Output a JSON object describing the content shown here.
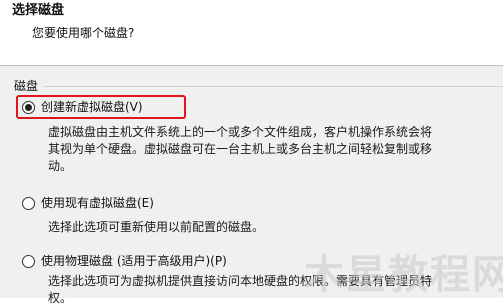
{
  "header": {
    "title": "选择磁盘",
    "subtitle": "您要使用哪个磁盘?"
  },
  "group": {
    "label": "磁盘"
  },
  "options": [
    {
      "label": "创建新虚拟磁盘(V)",
      "checked": true,
      "description_lines": [
        "虚拟磁盘由主机文件系统上的一个或多个文件组成，客户机操作系统会将",
        "其视为单个硬盘。虚拟磁盘可在一台主机上或多台主机之间轻松复制或移",
        "动。"
      ]
    },
    {
      "label": "使用现有虚拟磁盘(E)",
      "checked": false,
      "description_lines": [
        "选择此选项可重新使用以前配置的磁盘。"
      ]
    },
    {
      "label": "使用物理磁盘 (适用于高级用户)(P)",
      "checked": false,
      "description_lines": [
        "选择此选项可为虚拟机提供直接访问本地硬盘的权限。需要具有管理员特",
        "权。"
      ]
    }
  ],
  "watermark": "木星教程网",
  "colors": {
    "highlight_border": "#e0161c",
    "content_background": "#f0f0f0",
    "header_background": "#ffffff"
  }
}
